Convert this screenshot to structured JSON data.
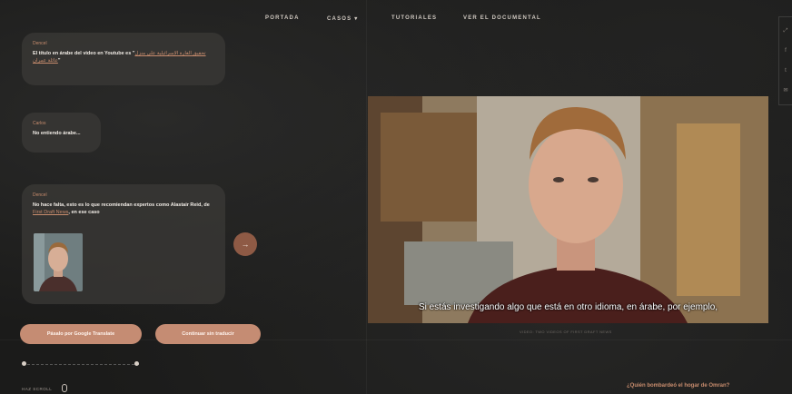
{
  "nav": {
    "items": [
      "PORTADA",
      "CASOS ▾",
      "TUTORIALES",
      "VER EL DOCUMENTAL"
    ]
  },
  "chat": {
    "message1": {
      "name": "Dencel",
      "text_before": "El título en árabe del video en Youtube es \"",
      "link": "تحقيق الغارة الإسرائيلية على منزل عائلة عمران",
      "text_after": "\""
    },
    "message2": {
      "name": "Carlos",
      "text": "No entiendo árabe..."
    },
    "message3": {
      "name": "Dencel",
      "text_before": "No hace falta, esto es lo que recomiendan expertos como Alastair Reid, de ",
      "link": "First Draft News",
      "text_after": ", en ese caso"
    }
  },
  "next_button": {
    "label": "→"
  },
  "actions": {
    "translate": "Pásalo por Google Translate",
    "continue": "Continuar sin traducir"
  },
  "progress": {
    "current": 1,
    "total": 2
  },
  "skip": {
    "label": "HAZ SCROLL"
  },
  "video": {
    "caption": "Si estás investigando algo que está en otro idioma, en árabe, por ejemplo,",
    "credit": "VIDEO: TWO VIDEOS OF FIRST DRAFT NEWS"
  },
  "next_story": {
    "label": "¿Quién bombardeó el hogar de Omran?"
  },
  "colors": {
    "accent": "#c58c73",
    "link": "#c98d6e",
    "background": "#1b1b1a"
  }
}
